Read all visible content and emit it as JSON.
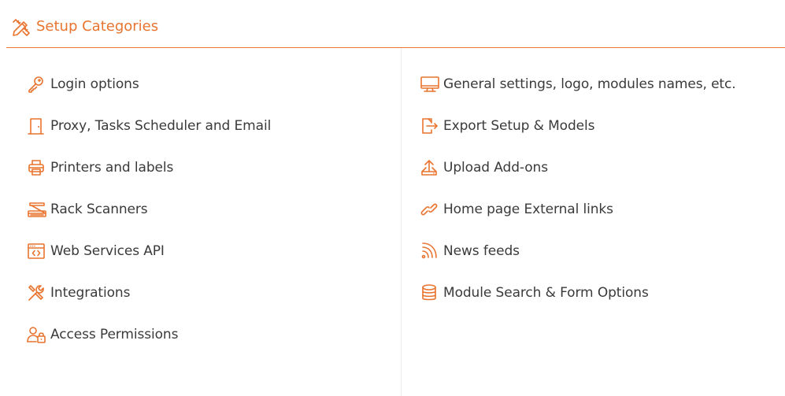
{
  "header": {
    "title": "Setup Categories",
    "icon": "pencil-ruler-icon",
    "accent_color": "#e9742f"
  },
  "left_items": [
    {
      "label": "Login options",
      "icon": "key-icon"
    },
    {
      "label": "Proxy, Tasks Scheduler and Email",
      "icon": "door-icon"
    },
    {
      "label": "Printers and labels",
      "icon": "printer-icon"
    },
    {
      "label": "Rack Scanners",
      "icon": "scanner-icon"
    },
    {
      "label": "Web Services API",
      "icon": "api-window-icon"
    },
    {
      "label": "Integrations",
      "icon": "tools-icon"
    },
    {
      "label": "Access Permissions",
      "icon": "user-lock-icon"
    }
  ],
  "right_items": [
    {
      "label": "General settings, logo, modules names, etc.",
      "icon": "monitor-icon"
    },
    {
      "label": "Export Setup & Models",
      "icon": "file-export-icon"
    },
    {
      "label": "Upload Add-ons",
      "icon": "upload-icon"
    },
    {
      "label": "Home page External links",
      "icon": "link-icon"
    },
    {
      "label": "News feeds",
      "icon": "rss-icon"
    },
    {
      "label": "Module Search & Form Options",
      "icon": "database-icon"
    }
  ]
}
